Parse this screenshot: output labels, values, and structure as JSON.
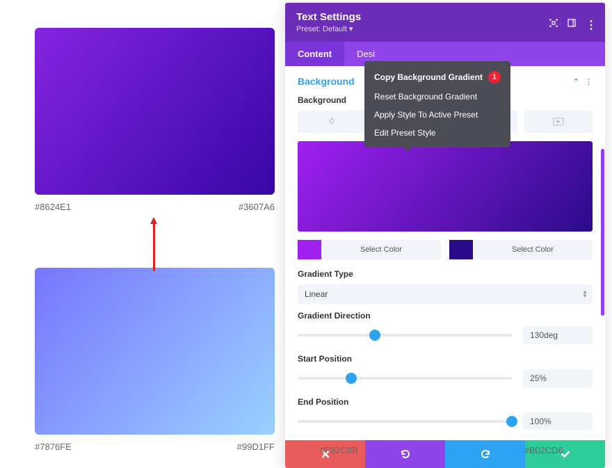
{
  "swatchA": {
    "color1": "#8624E1",
    "color2": "#3607A6",
    "label1": "#8624E1",
    "label2": "#3607A6"
  },
  "swatchB": {
    "color1": "#7876FE",
    "color2": "#99D1FF",
    "label1": "#7876FE",
    "label2": "#99D1FF"
  },
  "panel": {
    "title": "Text Settings",
    "preset": "Preset: Default ▾",
    "tabs": {
      "content": "Content",
      "design_partial": "Desi"
    }
  },
  "context_menu": {
    "copy": "Copy Background Gradient",
    "reset": "Reset Background Gradient",
    "apply": "Apply Style To Active Preset",
    "edit": "Edit Preset Style",
    "badge": "1"
  },
  "section": {
    "title": "Background",
    "bg_label": "Background"
  },
  "colors": {
    "select_label": "Select Color",
    "c1": "#a020f0",
    "c2": "#2a0b8a"
  },
  "gradient": {
    "type_label": "Gradient Type",
    "type_value": "Linear",
    "dir_label": "Gradient Direction",
    "dir_value": "130deg",
    "dir_pct": 36,
    "start_label": "Start Position",
    "start_value": "25%",
    "start_pct": 25,
    "end_label": "End Position",
    "end_value": "100%",
    "end_pct": 100
  },
  "footer": {
    "cancel_color": "#e85c5c",
    "undo_color": "#8e44e6",
    "redo_color": "#2ea3f2",
    "save_color": "#2ecc9a",
    "label_cancel": "#F92C8B",
    "label_save": "#B02CD6"
  }
}
